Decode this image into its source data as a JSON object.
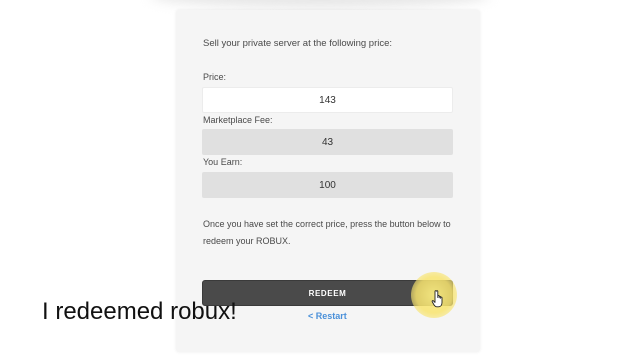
{
  "form": {
    "intro": "Sell your private server at the following price:",
    "price_label": "Price:",
    "price_value": "143",
    "fee_label": "Marketplace Fee:",
    "fee_value": "43",
    "earn_label": "You Earn:",
    "earn_value": "100",
    "instructions": "Once you have set the correct price, press the button below to redeem your ROBUX.",
    "redeem_label": "REDEEM",
    "restart_label": "< Restart"
  },
  "overlay": {
    "caption": "I redeemed robux!",
    "cursor_icon": "hand-pointer-icon",
    "highlight_color": "#f8e46e"
  },
  "colors": {
    "panel_bg": "#f5f5f5",
    "button_bg": "#4a4a4a",
    "link": "#4a90d9",
    "readonly_field": "#e0e0e0"
  }
}
